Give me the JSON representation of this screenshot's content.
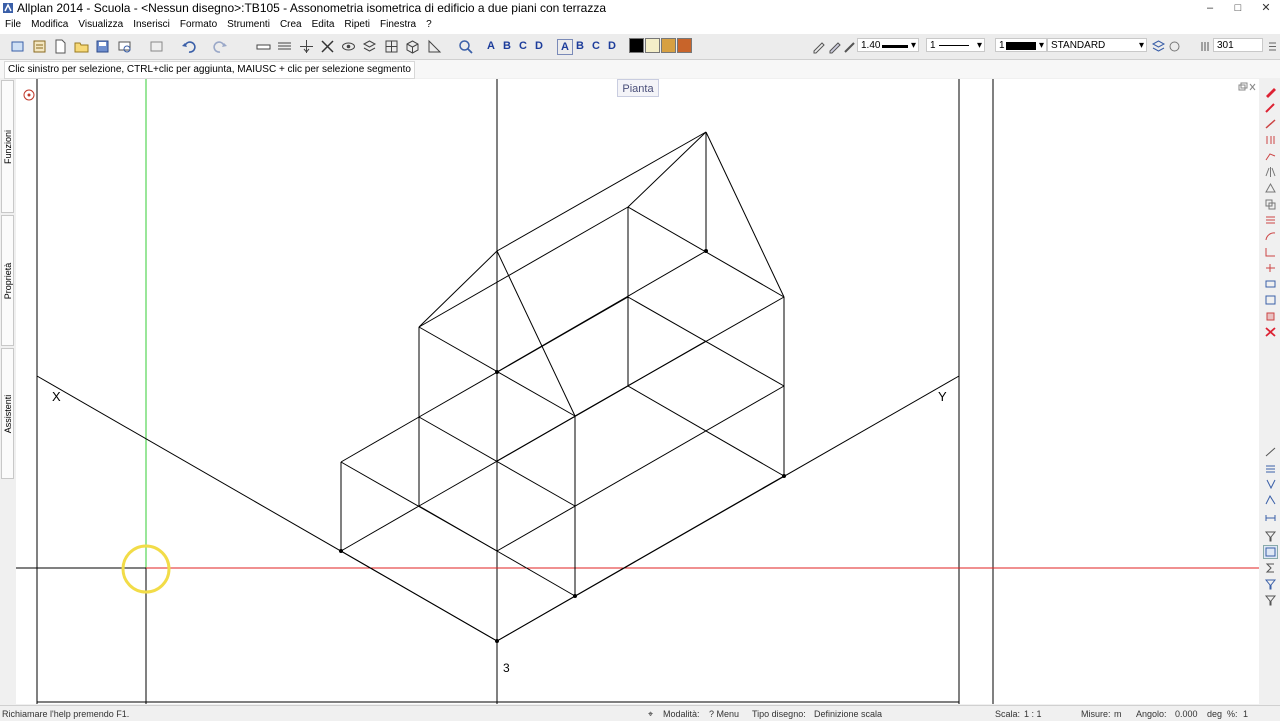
{
  "window": {
    "title": "Allplan 2014 - Scuola - <Nessun disegno>:TB105 - Assonometria isometrica di edificio a due piani con terrazza",
    "controls": [
      "–",
      "□",
      "✕"
    ]
  },
  "menu": [
    "File",
    "Modifica",
    "Visualizza",
    "Inserisci",
    "Formato",
    "Strumenti",
    "Crea",
    "Edita",
    "Ripeti",
    "Finestra",
    "?"
  ],
  "toolbar": {
    "text_buttons": [
      "A",
      "B",
      "C",
      "D",
      "A",
      "B",
      "C",
      "D"
    ],
    "colors": [
      "#000000",
      "#f4eec8",
      "#d7a042",
      "#c8642a"
    ],
    "pen_thickness": "1.40",
    "line_type": "1",
    "line_color": "1",
    "layer": "STANDARD",
    "number_field": "301"
  },
  "hint": "Clic sinistro per selezione, CTRL+clic per aggiunta, MAIUSC + clic per selezione segmento",
  "left_tabs": [
    "Funzioni",
    "Proprietà",
    "Assistenti"
  ],
  "viewport": {
    "view_label": "Pianta",
    "axis_x_label": "X",
    "axis_y_label": "Y",
    "origin_label": "3"
  },
  "status": {
    "help": "Richiamare l'help premendo F1.",
    "modalita_label": "Modalità:",
    "modalita_value": "? Menu",
    "tipo_label": "Tipo disegno:",
    "tipo_value": "Definizione scala",
    "scala_label": "Scala:",
    "scala_value": "1 : 1",
    "misure_label": "Misure:",
    "misure_value": "m",
    "angolo_label": "Angolo:",
    "angolo_value": "0.000",
    "deg_label": "deg",
    "percent_label": "%:",
    "percent_value": "1"
  }
}
